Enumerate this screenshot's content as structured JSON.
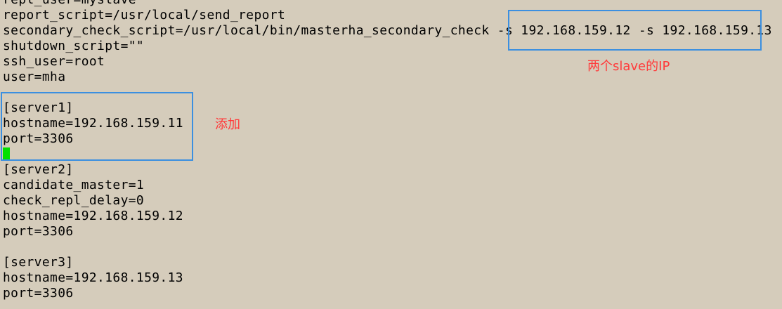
{
  "terminal": {
    "lines": [
      "repl_user=myslave",
      "report_script=/usr/local/send_report",
      "secondary_check_script=/usr/local/bin/masterha_secondary_check -s 192.168.159.12 -s 192.168.159.13",
      "shutdown_script=\"\"",
      "ssh_user=root",
      "user=mha",
      "",
      "[server1]",
      "hostname=192.168.159.11",
      "port=3306",
      "",
      "[server2]",
      "candidate_master=1",
      "check_repl_delay=0",
      "hostname=192.168.159.12",
      "port=3306",
      "",
      "[server3]",
      "hostname=192.168.159.13",
      "port=3306"
    ]
  },
  "annotations": {
    "slave_ip_note": "两个slave的IP",
    "add_note": "添加"
  },
  "colors": {
    "background": "#d5ccbb",
    "text": "#000000",
    "cursor": "#00e000",
    "highlight_box": "#3b8fe0",
    "annotation_text": "#ff3a3a"
  }
}
